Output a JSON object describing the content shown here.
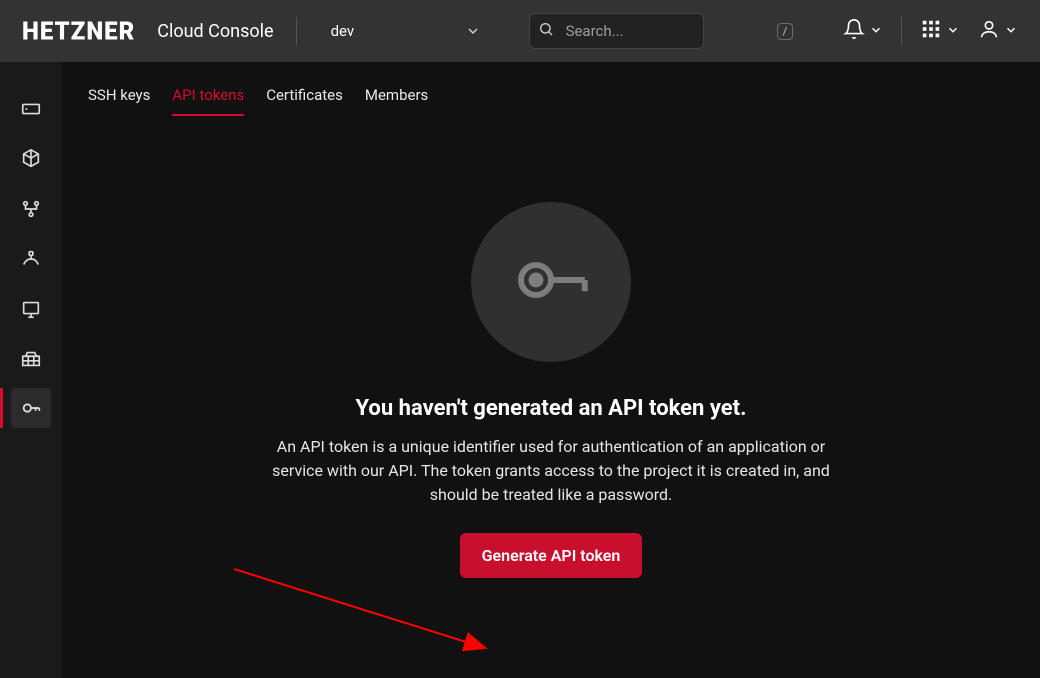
{
  "header": {
    "brand": "HETZNER",
    "product": "Cloud Console",
    "project": "dev",
    "search_placeholder": "Search...",
    "search_kbd": "/"
  },
  "sidebar": {
    "items": [
      {
        "name": "servers-icon"
      },
      {
        "name": "volumes-icon"
      },
      {
        "name": "networks-icon"
      },
      {
        "name": "load-balancers-icon"
      },
      {
        "name": "floating-ips-icon"
      },
      {
        "name": "firewalls-icon"
      },
      {
        "name": "security-icon"
      }
    ]
  },
  "tabs": [
    {
      "key": "ssh",
      "label": "SSH keys"
    },
    {
      "key": "api",
      "label": "API tokens"
    },
    {
      "key": "cert",
      "label": "Certificates"
    },
    {
      "key": "members",
      "label": "Members"
    }
  ],
  "empty": {
    "title": "You haven't generated an API token yet.",
    "body": "An API token is a unique identifier used for authentication of an application or service with our API. The token grants access to the project it is created in, and should be treated like a password.",
    "button": "Generate API token"
  },
  "colors": {
    "accent": "#d50c2d"
  }
}
